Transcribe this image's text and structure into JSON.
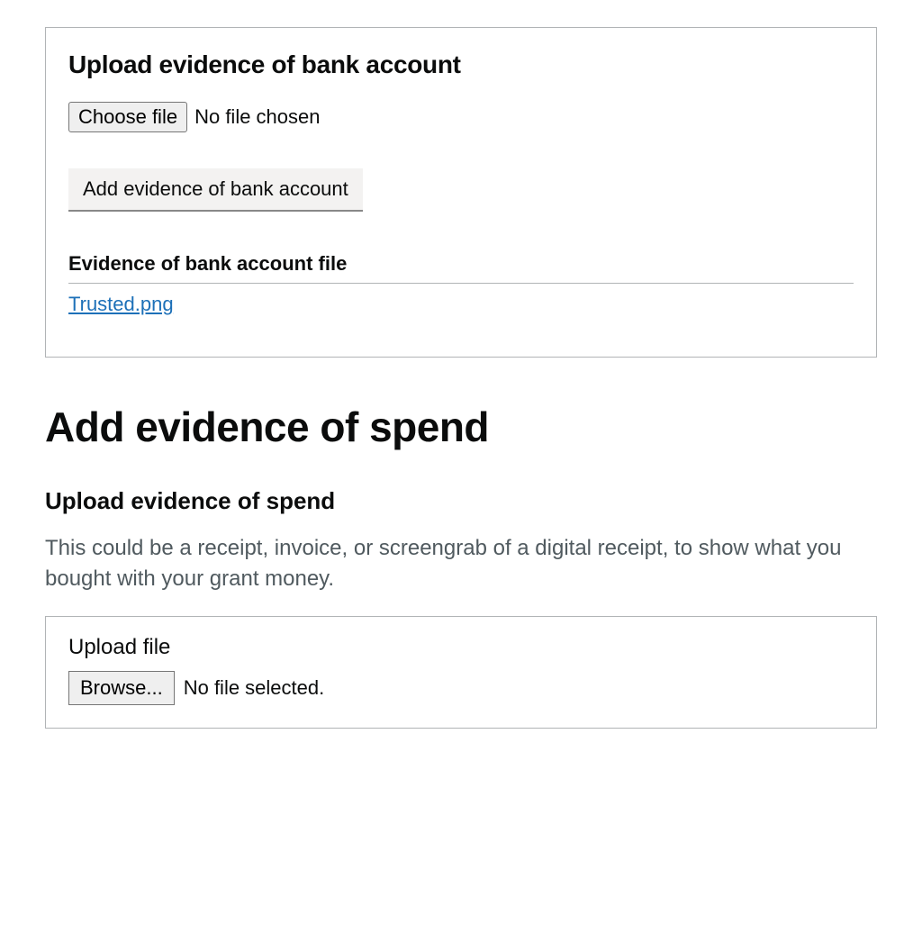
{
  "bank_panel": {
    "title": "Upload evidence of bank account",
    "choose_button": "Choose file",
    "choose_status": "No file chosen",
    "add_button": "Add evidence of bank account",
    "file_heading": "Evidence of bank account file",
    "file_link": "Trusted.png"
  },
  "spend_section": {
    "heading": "Add evidence of spend",
    "sub_heading": "Upload evidence of spend",
    "hint": "This could be a receipt, invoice, or screengrab of a digital receipt, to show what you bought with your grant money.",
    "upload_label": "Upload file",
    "browse_button": "Browse...",
    "browse_status": "No file selected."
  }
}
